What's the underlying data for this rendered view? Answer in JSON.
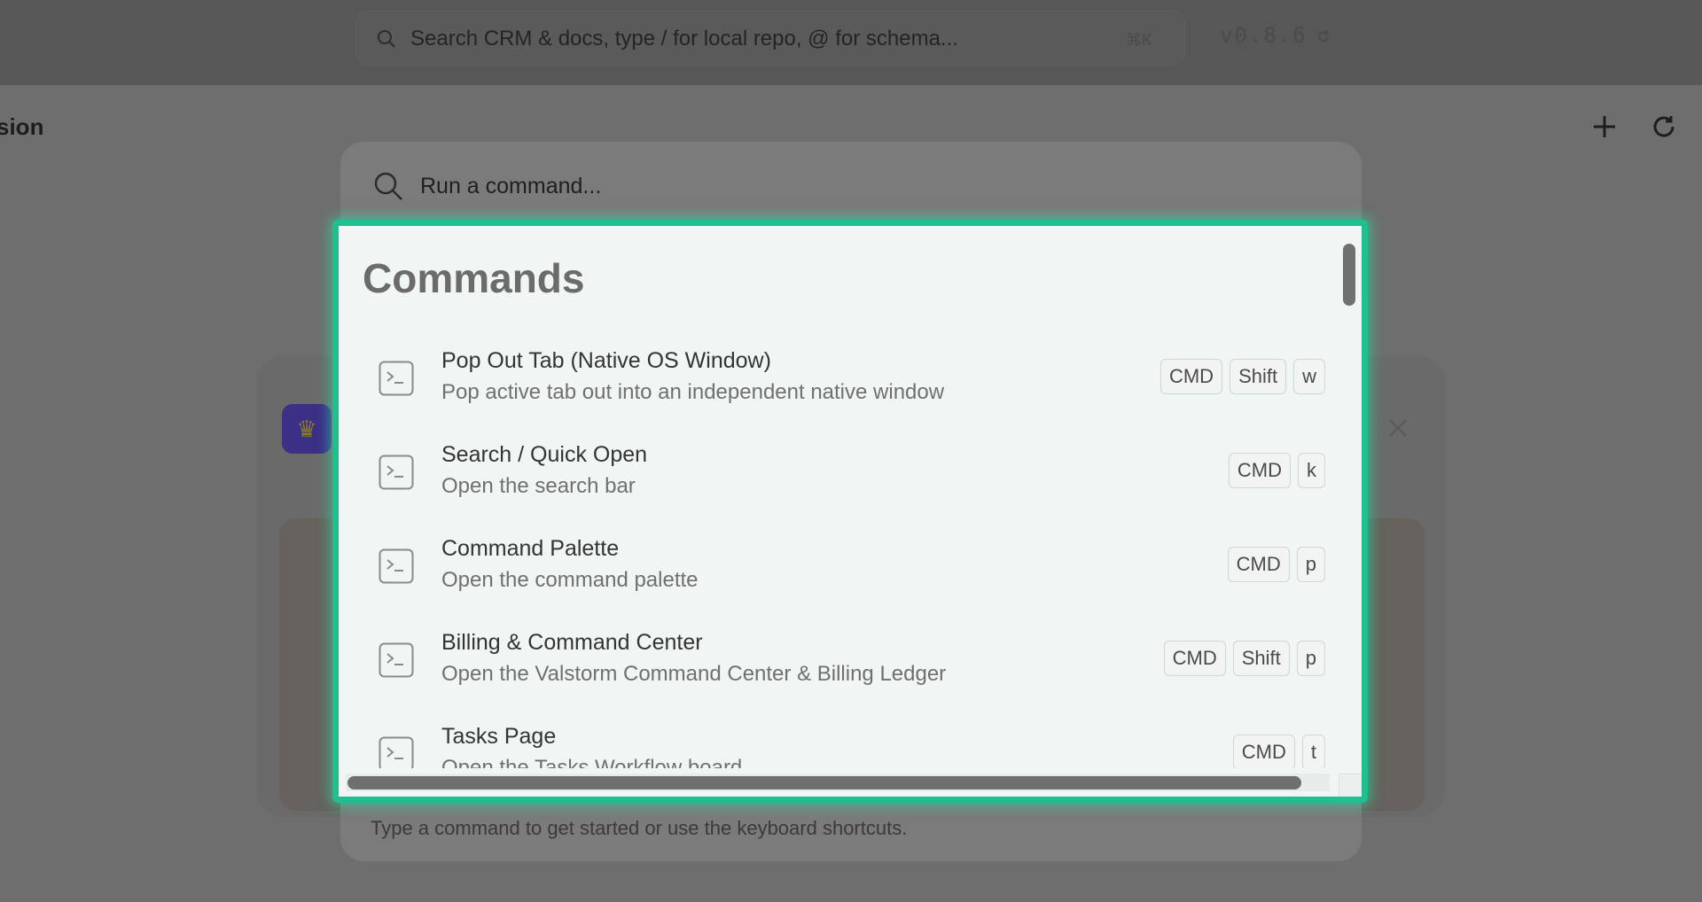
{
  "app": {
    "search_placeholder": "Search CRM & docs, type / for local repo, @ for schema...",
    "search_shortcut": "⌘K",
    "version": "v0.8.6",
    "page_title": "sion"
  },
  "palette": {
    "input_placeholder": "Run a command...",
    "section_title": "Commands",
    "footer_text": "Type a command to get started or use the keyboard shortcuts.",
    "commands": [
      {
        "title": "Pop Out Tab (Native OS Window)",
        "description": "Pop active tab out into an independent native window",
        "keys": [
          "CMD",
          "Shift",
          "w"
        ]
      },
      {
        "title": "Search / Quick Open",
        "description": "Open the search bar",
        "keys": [
          "CMD",
          "k"
        ]
      },
      {
        "title": "Command Palette",
        "description": "Open the command palette",
        "keys": [
          "CMD",
          "p"
        ]
      },
      {
        "title": "Billing & Command Center",
        "description": "Open the Valstorm Command Center & Billing Ledger",
        "keys": [
          "CMD",
          "Shift",
          "p"
        ]
      },
      {
        "title": "Tasks Page",
        "description": "Open the Tasks Workflow board",
        "keys": [
          "CMD",
          "t"
        ]
      }
    ]
  },
  "colors": {
    "highlight_border": "#1fbf8f",
    "list_background": "#eff6f4",
    "overlay": "#6e6e6e"
  },
  "icons": {
    "command_item": "terminal-icon",
    "palette_search": "search-icon"
  }
}
